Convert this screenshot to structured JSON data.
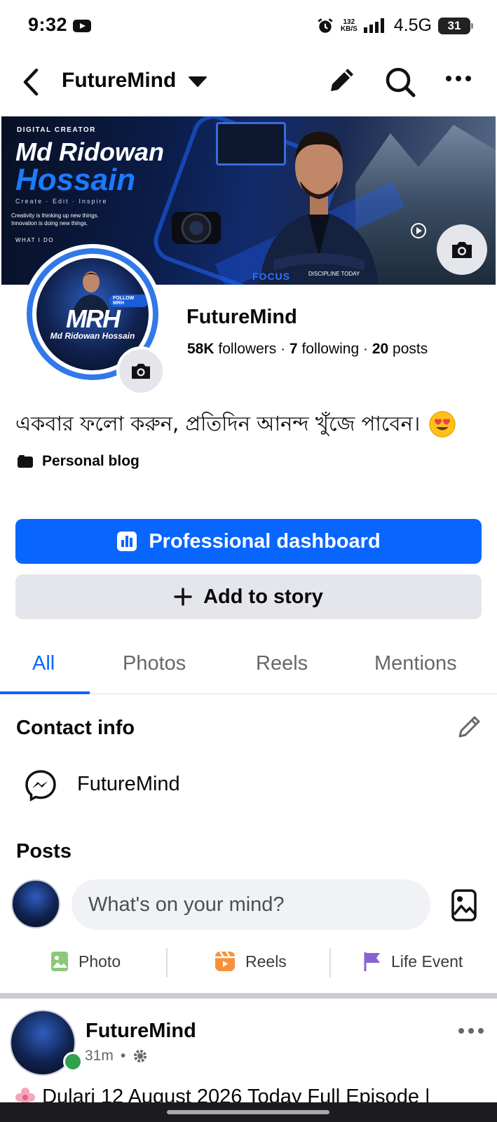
{
  "status_bar": {
    "time": "9:32",
    "speed_value": "132",
    "speed_unit": "KB/S",
    "network": "4.5G",
    "battery": "31"
  },
  "header": {
    "title": "FutureMind"
  },
  "cover": {
    "kicker": "DIGITAL CREATOR",
    "name_line1": "Md Ridowan",
    "name_line2": "Hossain",
    "tagline": "Create · Edit · Inspire",
    "quote": "Creativity is thinking up new things. Innovation is doing new things.",
    "what_i_do": "WHAT I DO",
    "focus": "FOCUS",
    "discipline": "DISCIPLINE TODAY"
  },
  "avatar": {
    "monogram": "MRH",
    "name": "Md Ridowan Hossain",
    "follow_badge": "FOLLOW MRH"
  },
  "profile": {
    "name": "FutureMind",
    "followers_count": "58K",
    "followers_label": "followers",
    "following_count": "7",
    "following_label": "following",
    "posts_count": "20",
    "posts_label": "posts",
    "bio": "একবার ফলো করুন, প্রতিদিন আনন্দ খুঁজে পাবেন।",
    "category": "Personal blog"
  },
  "buttons": {
    "dashboard": "Professional dashboard",
    "story": "Add to story"
  },
  "tabs": [
    {
      "label": "All",
      "active": true
    },
    {
      "label": "Photos",
      "active": false
    },
    {
      "label": "Reels",
      "active": false
    },
    {
      "label": "Mentions",
      "active": false
    }
  ],
  "contact": {
    "title": "Contact info",
    "messenger": "FutureMind"
  },
  "posts_section": {
    "title": "Posts",
    "composer_placeholder": "What's on your mind?",
    "actions": {
      "photo": "Photo",
      "reels": "Reels",
      "life_event": "Life Event"
    }
  },
  "post": {
    "author": "FutureMind",
    "time": "31m",
    "separator": "•",
    "text": "Dulari 12 August 2026 Today Full Episode |"
  },
  "colors": {
    "accent": "#0866ff",
    "ring": "#3179e8",
    "online": "#31a24c"
  }
}
